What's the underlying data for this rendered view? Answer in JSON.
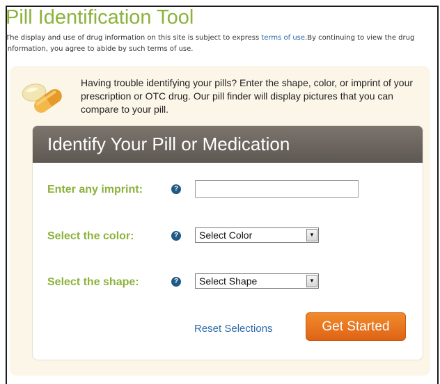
{
  "page": {
    "title": "Pill Identification Tool",
    "disclaimer_before_link": "The display and use of drug information on this site is subject to express ",
    "terms_link": "terms of use",
    "disclaimer_after_link": ".By continuing to view the drug information, you agree to abide by such terms of use."
  },
  "intro": {
    "text": "Having trouble identifying your pills? Enter the shape, color, or imprint of your prescription or OTC drug. Our pill finder will display pictures that you can compare to your pill."
  },
  "form": {
    "heading": "Identify Your Pill or Medication",
    "imprint_label": "Enter any imprint:",
    "imprint_value": "",
    "color_label": "Select the color:",
    "color_selected": "Select Color",
    "shape_label": "Select the shape:",
    "shape_selected": "Select Shape",
    "help_glyph": "?",
    "dropdown_glyph": "▼",
    "reset_label": "Reset Selections",
    "submit_label": "Get Started"
  },
  "colors": {
    "title_green": "#8cb23c",
    "link_blue": "#2c6aa8",
    "button_orange": "#e8721f",
    "header_brown": "#6e6760",
    "panel_cream": "#fbf6e8"
  },
  "icons": {
    "pills": "pills-icon",
    "help": "help-icon",
    "dropdown": "chevron-down-icon"
  }
}
